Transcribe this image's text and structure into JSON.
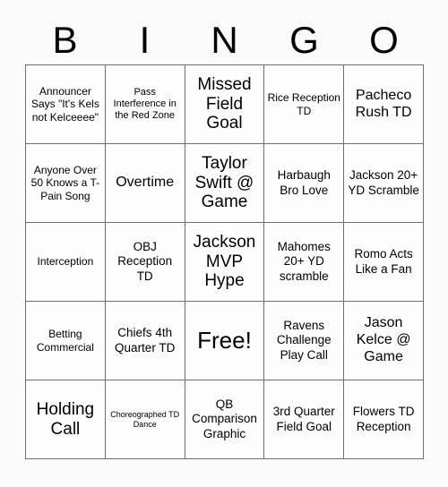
{
  "header": {
    "letters": [
      "B",
      "I",
      "N",
      "G",
      "O"
    ]
  },
  "grid": {
    "rows": 5,
    "columns": 5,
    "cells": [
      {
        "text": "Announcer Says \"It's Kels not Kelceeee\"",
        "size": "s"
      },
      {
        "text": "Pass Interference in the Red Zone",
        "size": "xs"
      },
      {
        "text": "Missed Field Goal",
        "size": "xl"
      },
      {
        "text": "Rice Reception TD",
        "size": "s"
      },
      {
        "text": "Pacheco Rush TD",
        "size": "l"
      },
      {
        "text": "Anyone Over 50 Knows a T-Pain Song",
        "size": "s"
      },
      {
        "text": "Overtime",
        "size": "l"
      },
      {
        "text": "Taylor Swift @ Game",
        "size": "xl"
      },
      {
        "text": "Harbaugh Bro Love",
        "size": "m"
      },
      {
        "text": "Jackson 20+ YD Scramble",
        "size": "m"
      },
      {
        "text": "Interception",
        "size": "s"
      },
      {
        "text": "OBJ Reception TD",
        "size": "m"
      },
      {
        "text": "Jackson MVP Hype",
        "size": "xl"
      },
      {
        "text": "Mahomes 20+ YD scramble",
        "size": "m"
      },
      {
        "text": "Romo Acts Like a Fan",
        "size": "m"
      },
      {
        "text": "Betting Commercial",
        "size": "s"
      },
      {
        "text": "Chiefs 4th Quarter TD",
        "size": "m"
      },
      {
        "text": "Free!",
        "size": "xxl"
      },
      {
        "text": "Ravens Challenge Play Call",
        "size": "m"
      },
      {
        "text": "Jason Kelce @ Game",
        "size": "l"
      },
      {
        "text": "Holding Call",
        "size": "xl"
      },
      {
        "text": "Choreographed TD Dance",
        "size": "xxs"
      },
      {
        "text": "QB Comparison Graphic",
        "size": "m"
      },
      {
        "text": "3rd Quarter Field Goal",
        "size": "m"
      },
      {
        "text": "Flowers TD Reception",
        "size": "m"
      }
    ]
  },
  "colors": {
    "background": "#fafafa",
    "cell_background": "#fdfdfd",
    "border": "#6e6e6e",
    "text": "#000000"
  }
}
